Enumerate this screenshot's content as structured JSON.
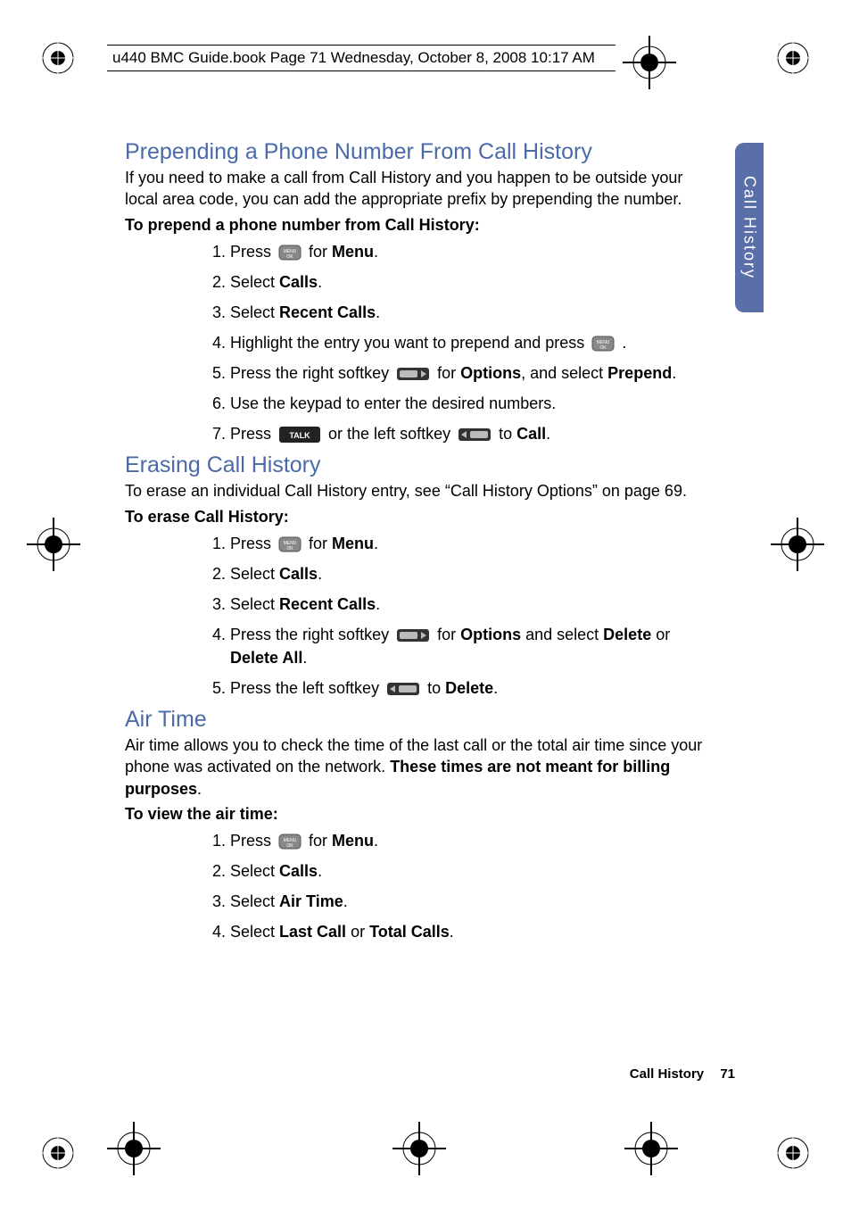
{
  "header": "u440 BMC Guide.book  Page 71  Wednesday, October 8, 2008  10:17 AM",
  "side_tab": "Call History",
  "sections": {
    "prepend": {
      "title": "Prepending a Phone Number From Call History",
      "intro": "If you need to make a call from Call History and you happen to be outside your local area code, you can add the appropriate prefix by prepending the number.",
      "lead": "To prepend a phone number from Call History:",
      "steps": {
        "s1a": "Press ",
        "s1b": " for ",
        "s1c": "Menu",
        "s1d": ".",
        "s2a": "Select ",
        "s2b": "Calls",
        "s2c": ".",
        "s3a": "Select ",
        "s3b": "Recent Calls",
        "s3c": ".",
        "s4a": "Highlight the entry you want to prepend and press ",
        "s4b": ".",
        "s5a": "Press the right softkey ",
        "s5b": " for ",
        "s5c": "Options",
        "s5d": ", and select ",
        "s5e": "Prepend",
        "s5f": ".",
        "s6": "Use the keypad to enter the desired numbers.",
        "s7a": "Press ",
        "s7b": " or the left softkey ",
        "s7c": " to ",
        "s7d": "Call",
        "s7e": "."
      }
    },
    "erase": {
      "title": "Erasing Call History",
      "intro": "To erase an individual Call History entry, see “Call History Options” on page 69.",
      "lead": "To erase Call History:",
      "steps": {
        "s1a": "Press ",
        "s1b": " for ",
        "s1c": "Menu",
        "s1d": ".",
        "s2a": "Select ",
        "s2b": "Calls",
        "s2c": ".",
        "s3a": "Select ",
        "s3b": "Recent Calls",
        "s3c": ".",
        "s4a": "Press the right softkey ",
        "s4b": " for ",
        "s4c": "Options",
        "s4d": " and select ",
        "s4e": "Delete",
        "s4f": " or ",
        "s4g": "Delete All",
        "s4h": ".",
        "s5a": "Press the left softkey ",
        "s5b": " to ",
        "s5c": "Delete",
        "s5d": "."
      }
    },
    "airtime": {
      "title": "Air Time",
      "intro_a": "Air time allows you to check the time of the last call or the total air time since your phone was activated on the network. ",
      "intro_b": "These times are not meant for billing purposes",
      "intro_c": ".",
      "lead": "To view the air time:",
      "steps": {
        "s1a": "Press ",
        "s1b": " for ",
        "s1c": "Menu",
        "s1d": ".",
        "s2a": "Select ",
        "s2b": "Calls",
        "s2c": ".",
        "s3a": "Select ",
        "s3b": "Air Time",
        "s3c": ".",
        "s4a": "Select ",
        "s4b": "Last Call",
        "s4c": " or ",
        "s4d": "Total Calls",
        "s4e": "."
      }
    }
  },
  "footer": {
    "label": "Call History",
    "page": "71"
  }
}
